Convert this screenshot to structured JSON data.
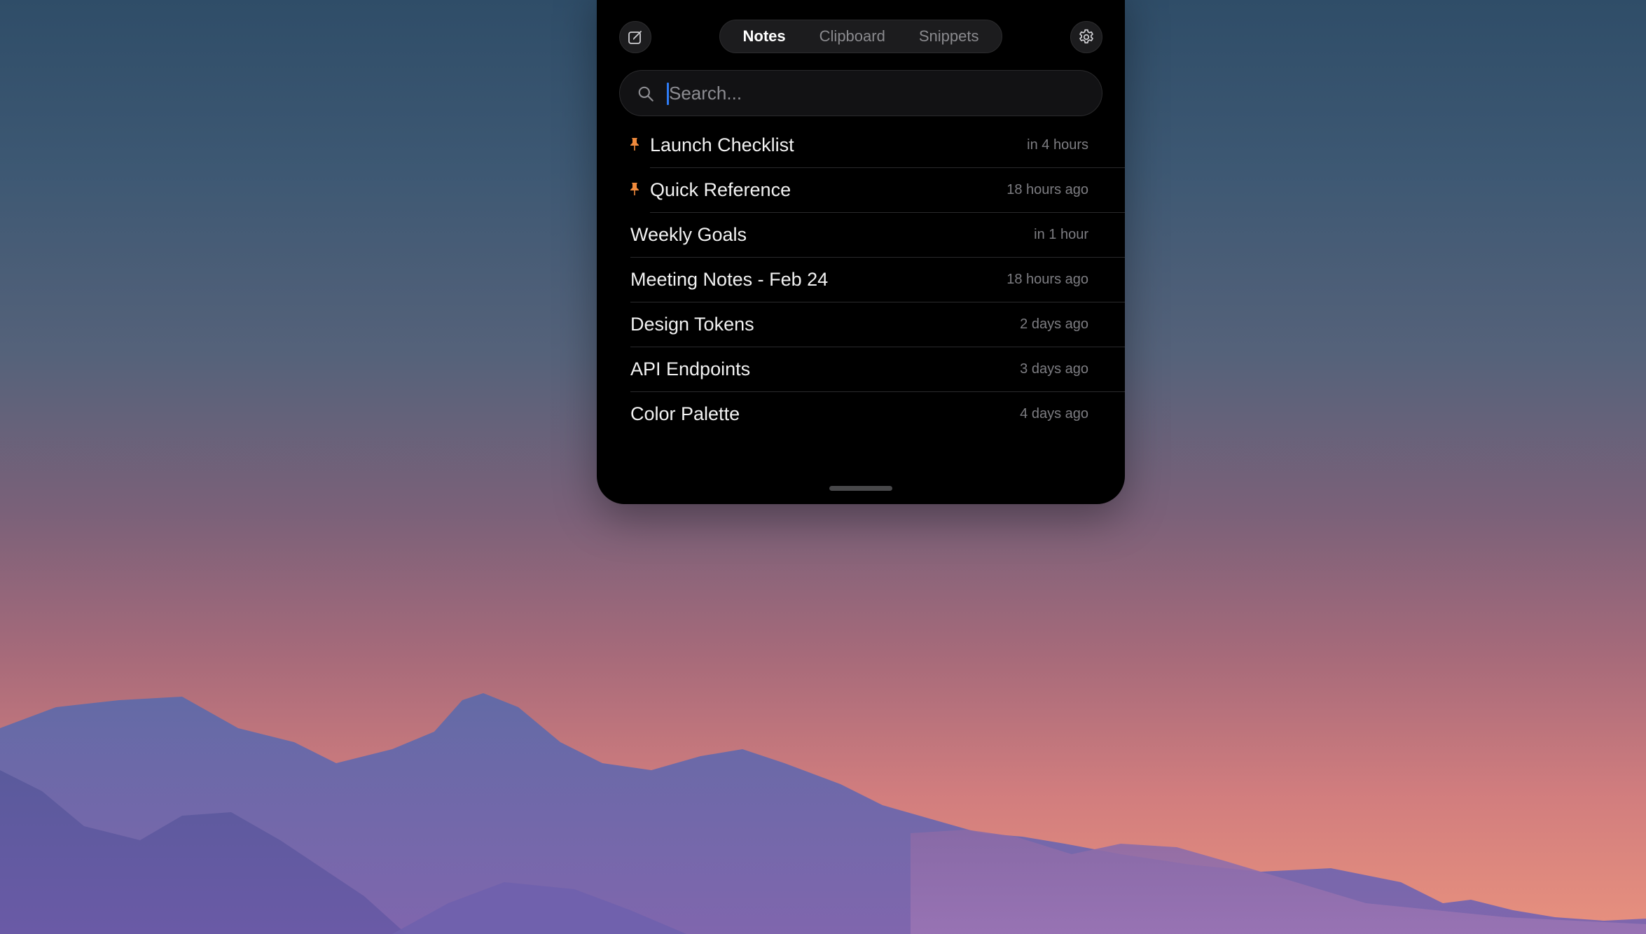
{
  "header": {
    "tabs": [
      {
        "label": "Notes",
        "active": true
      },
      {
        "label": "Clipboard",
        "active": false
      },
      {
        "label": "Snippets",
        "active": false
      }
    ],
    "compose_icon": "compose-icon",
    "settings_icon": "gear-icon"
  },
  "search": {
    "placeholder": "Search...",
    "value": ""
  },
  "notes": [
    {
      "title": "Launch Checklist",
      "time": "in 4 hours",
      "pinned": true
    },
    {
      "title": "Quick Reference",
      "time": "18 hours ago",
      "pinned": true
    },
    {
      "title": "Weekly Goals",
      "time": "in 1 hour",
      "pinned": false
    },
    {
      "title": "Meeting Notes - Feb 24",
      "time": "18 hours ago",
      "pinned": false
    },
    {
      "title": "Design Tokens",
      "time": "2 days ago",
      "pinned": false
    },
    {
      "title": "API Endpoints",
      "time": "3 days ago",
      "pinned": false
    },
    {
      "title": "Color Palette",
      "time": "4 days ago",
      "pinned": false
    }
  ],
  "colors": {
    "panel_background": "#000000",
    "pin_color": "#f08a3c",
    "caret_color": "#2f7cf6"
  }
}
